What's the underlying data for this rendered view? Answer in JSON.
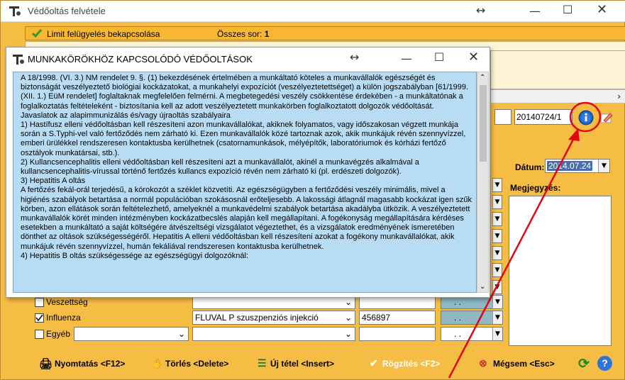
{
  "outer": {
    "title": "Védőoltás felvétele",
    "limit_label": "Limit felügyelés bekapcsolása",
    "total_label": "Összes sor:",
    "total_value": "1",
    "code_field": "20140724/1",
    "date_label": "Dátum:",
    "date_value": "2014.07.24",
    "note_label": "Megjegyzés:"
  },
  "dialog": {
    "title": "MUNKAKÖRÖKHÖZ KAPCSOLÓDÓ VÉDŐOLTÁSOK",
    "paragraphs": [
      "A 18/1998. (VI. 3.) NM rendelet 9. §. (1) bekezdésének értelmében a munkáltató köteles a munkavállalók egészségét és biztonságát veszélyeztető biológiai kockázatokat, a munkahelyi expozíciót (veszélyeztetettséget) a külön jogszabályban [61/1999. (XII. 1.) EüM rendelet] foglaltaknak megfelelően felmérni. A megbetegedési veszély csökkentése érdekében - a munkáltatónak a foglalkoztatás feltételeként - biztosítania kell az adott veszélyeztetett munkakörben foglalkoztatott dolgozók védőoltását.",
      "Javaslatok az alapimmunizálás és/vagy újraoltás szabályaira",
      "1) Hastífusz elleni védőoltásban kell részesíteni azon munkavállalókat, akiknek folyamatos, vagy időszakosan végzett munkája során a S.Typhi-vel való fertőződés nem zárható ki. Ezen munkavállalók közé tartoznak azok, akik munkájuk révén szennyvízzel, emberi ürülékkel rendszeresen kontaktusba kerülhetnek (csatornamunkások, mélyépítők, laboratóriumok és kórházi fertőző osztályok munkatársai, stb.).",
      "2)          Kullancsencephalitis elleni védőoltásban kell részesíteni azt a munkavállalót, akinél a munkavégzés alkalmával a kullancsencephalitis-vírussal történő fertőzés kullancs expozíció révén nem zárható ki (pl. erdészeti dolgozók).",
      "3)          Hepatitis A oltás",
      "A fertőzés fekál-orál terjedésű, a kórokozót a széklet közvetíti. Az egészségügyben a fertőződési veszély minimális, mivel a higiénés szabályok betartása a normál populációban szokásosnál erőteljesebb. A lakossági átlagnál magasabb kockázat igen szűk körben, azon ellátások során feltételezhető, amelyeknél a munkavédelmi szabályok betartása akadályba ütközik. A veszélyeztetett munkavállalók körét minden intézményben kockázatbecslés alapján kell megállapítani. A fogékonyság megállapítására kérdéses esetekben a munkáltató a saját költségére átvészeltségi vizsgálatot végeztethet, és a vizsgálatok eredményének ismeretében dönthet az oltások szükségességéről. Hepatitis A elleni védőoltásban kell részesíteni azokat a fogékony munkavállalókat, akik munkájuk révén szennyvízzel, humán fekáliával rendszeresen kontaktusba kerülhetnek.",
      "4)          Hepatitis B oltás szükségessége az egészségügyi dolgozóknál:"
    ]
  },
  "rows": [
    {
      "label": "Veszettség",
      "vaccine": "",
      "code": "",
      "date": ". ."
    },
    {
      "label": "Influenza",
      "vaccine": "FLUVAL P szuszpenziós injekció",
      "code": "456897",
      "date": ". ."
    },
    {
      "label": "Egyéb",
      "vaccine": "",
      "code": "",
      "date": ". ."
    }
  ],
  "side_dates": [
    ". .",
    ". .",
    ". .",
    ". .",
    ". .",
    ". .",
    ". ."
  ],
  "buttons": {
    "print": "Nyomtatás <F12>",
    "delete": "Törlés <Delete>",
    "new": "Új tétel <Insert>",
    "save": "Rögzítés <F2>",
    "cancel": "Mégsem <Esc>"
  },
  "colors": {
    "window_bg": "#f6bd45",
    "dialog_text_bg": "#b8dcf4",
    "annotation": "#e30613"
  }
}
